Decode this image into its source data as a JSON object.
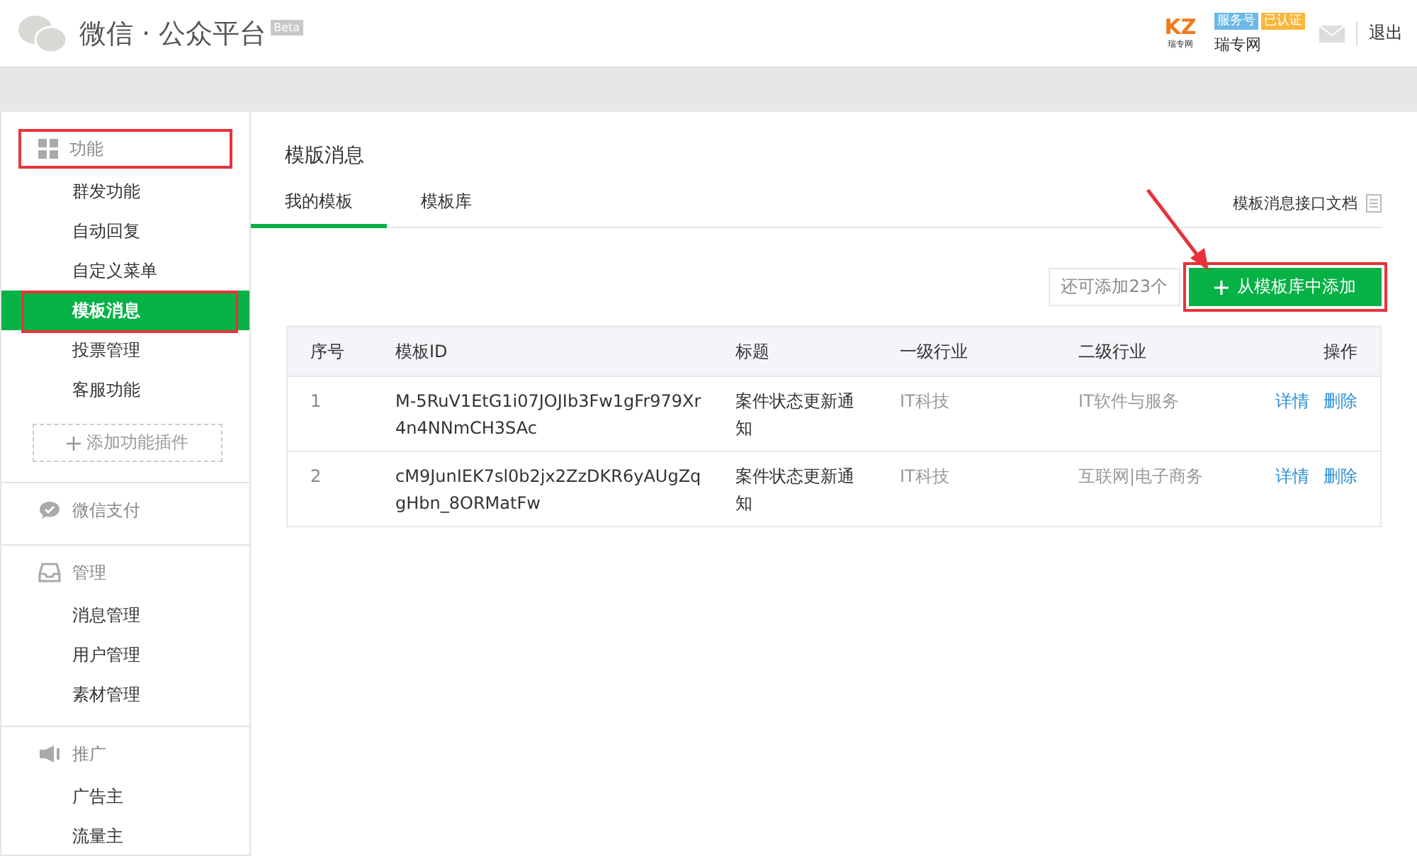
{
  "header": {
    "title": "微信 · 公众平台",
    "badge": "Beta",
    "account": {
      "logo_mark": "KZ",
      "logo_caption": "瑞专网",
      "tags": [
        {
          "label": "服务号",
          "color": "#6cb8e6"
        },
        {
          "label": "已认证",
          "color": "#f6b73c"
        }
      ],
      "name": "瑞专网"
    },
    "logout": "退出"
  },
  "sidebar": {
    "sections": [
      {
        "title": "功能",
        "highlighted": true,
        "items": [
          {
            "label": "群发功能",
            "selected": false,
            "highlighted": false
          },
          {
            "label": "自动回复",
            "selected": false,
            "highlighted": false
          },
          {
            "label": "自定义菜单",
            "selected": false,
            "highlighted": false
          },
          {
            "label": "模板消息",
            "selected": true,
            "highlighted": true
          },
          {
            "label": "投票管理",
            "selected": false,
            "highlighted": false
          },
          {
            "label": "客服功能",
            "selected": false,
            "highlighted": false
          }
        ],
        "add_plugin": "添加功能插件"
      },
      {
        "title": "微信支付",
        "highlighted": false
      },
      {
        "title": "管理",
        "highlighted": false,
        "items": [
          {
            "label": "消息管理",
            "selected": false,
            "highlighted": false
          },
          {
            "label": "用户管理",
            "selected": false,
            "highlighted": false
          },
          {
            "label": "素材管理",
            "selected": false,
            "highlighted": false
          }
        ]
      },
      {
        "title": "推广",
        "highlighted": false,
        "items": [
          {
            "label": "广告主",
            "selected": false,
            "highlighted": false
          },
          {
            "label": "流量主",
            "selected": false,
            "highlighted": false
          }
        ]
      }
    ]
  },
  "main": {
    "title": "模版消息",
    "tabs": [
      {
        "label": "我的模板",
        "selected": true
      },
      {
        "label": "模板库",
        "selected": false
      }
    ],
    "doc_link": "模板消息接口文档",
    "remaining": "还可添加23个",
    "add_button": {
      "label": "从模板库中添加",
      "highlighted": true
    },
    "table": {
      "columns": [
        "序号",
        "模板ID",
        "标题",
        "一级行业",
        "二级行业",
        "操作"
      ],
      "rows": [
        {
          "index": "1",
          "template_id": "M-5RuV1EtG1i07JOJIb3Fw1gFr979Xr4n4NNmCH3SAc",
          "title": "案件状态更新通知",
          "industry_1": "IT科技",
          "industry_2": "IT软件与服务",
          "actions": [
            "详情",
            "删除"
          ]
        },
        {
          "index": "2",
          "template_id": "cM9JunIEK7sl0b2jx2ZzDKR6yAUgZqgHbn_8ORMatFw",
          "title": "案件状态更新通知",
          "industry_1": "IT科技",
          "industry_2": "互联网|电子商务",
          "actions": [
            "详情",
            "删除"
          ]
        }
      ]
    }
  }
}
